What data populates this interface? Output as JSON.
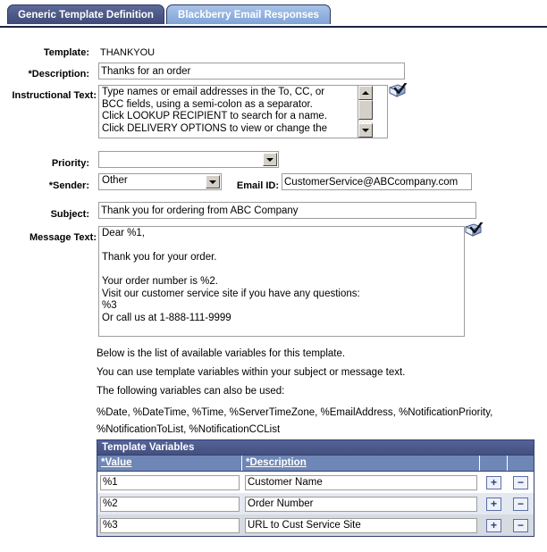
{
  "tabs": [
    {
      "label": "Generic Template Definition",
      "active": true
    },
    {
      "label": "Blackberry Email Responses",
      "active": false
    }
  ],
  "form": {
    "template_label": "Template:",
    "template_value": "THANKYOU",
    "description_label": "*Description:",
    "description_value": "Thanks for an order",
    "instructional_label": "Instructional Text:",
    "instructional_value": "Type names or email addresses in the To, CC, or\nBCC fields, using a semi-colon as a separator.\nClick LOOKUP RECIPIENT to search for a name.\nClick DELIVERY OPTIONS to view or change the",
    "priority_label": "Priority:",
    "priority_value": "",
    "sender_label": "*Sender:",
    "sender_value": "Other",
    "emailid_label": "Email ID:",
    "emailid_value": "CustomerService@ABCcompany.com",
    "subject_label": "Subject:",
    "subject_value": "Thank you for ordering from ABC Company",
    "message_label": "Message Text:",
    "message_value": "Dear %1,\n\nThank you for your order.\n\nYour order number is %2.\nVisit our customer service site if you have any questions:\n%3\nOr call us at 1-888-111-9999"
  },
  "help": [
    "Below is the list of available variables for this template.",
    "You can use template variables within your subject or message text.",
    "The following variables can also be used:",
    "%Date, %DateTime, %Time, %ServerTimeZone, %EmailAddress, %NotificationPriority,",
    "%NotificationToList, %NotificationCCList"
  ],
  "grid": {
    "title": "Template Variables",
    "columns": [
      "*Value",
      "*Description",
      "",
      ""
    ],
    "add_label": "+",
    "remove_label": "−",
    "rows": [
      {
        "value": "%1",
        "description": "Customer Name"
      },
      {
        "value": "%2",
        "description": "Order Number"
      },
      {
        "value": "%3",
        "description": "URL to Cust Service Site"
      }
    ]
  },
  "icons": {
    "spellcheck_instructional": "spellcheck-icon",
    "spellcheck_message": "spellcheck-icon"
  },
  "colors": {
    "tab_active": "#4b5784",
    "tab_inactive": "#8fb0dd",
    "grid_title_bg": "#4a5788",
    "grid_header_bg": "#6f87b6",
    "field_border": "#9d9d9d"
  }
}
